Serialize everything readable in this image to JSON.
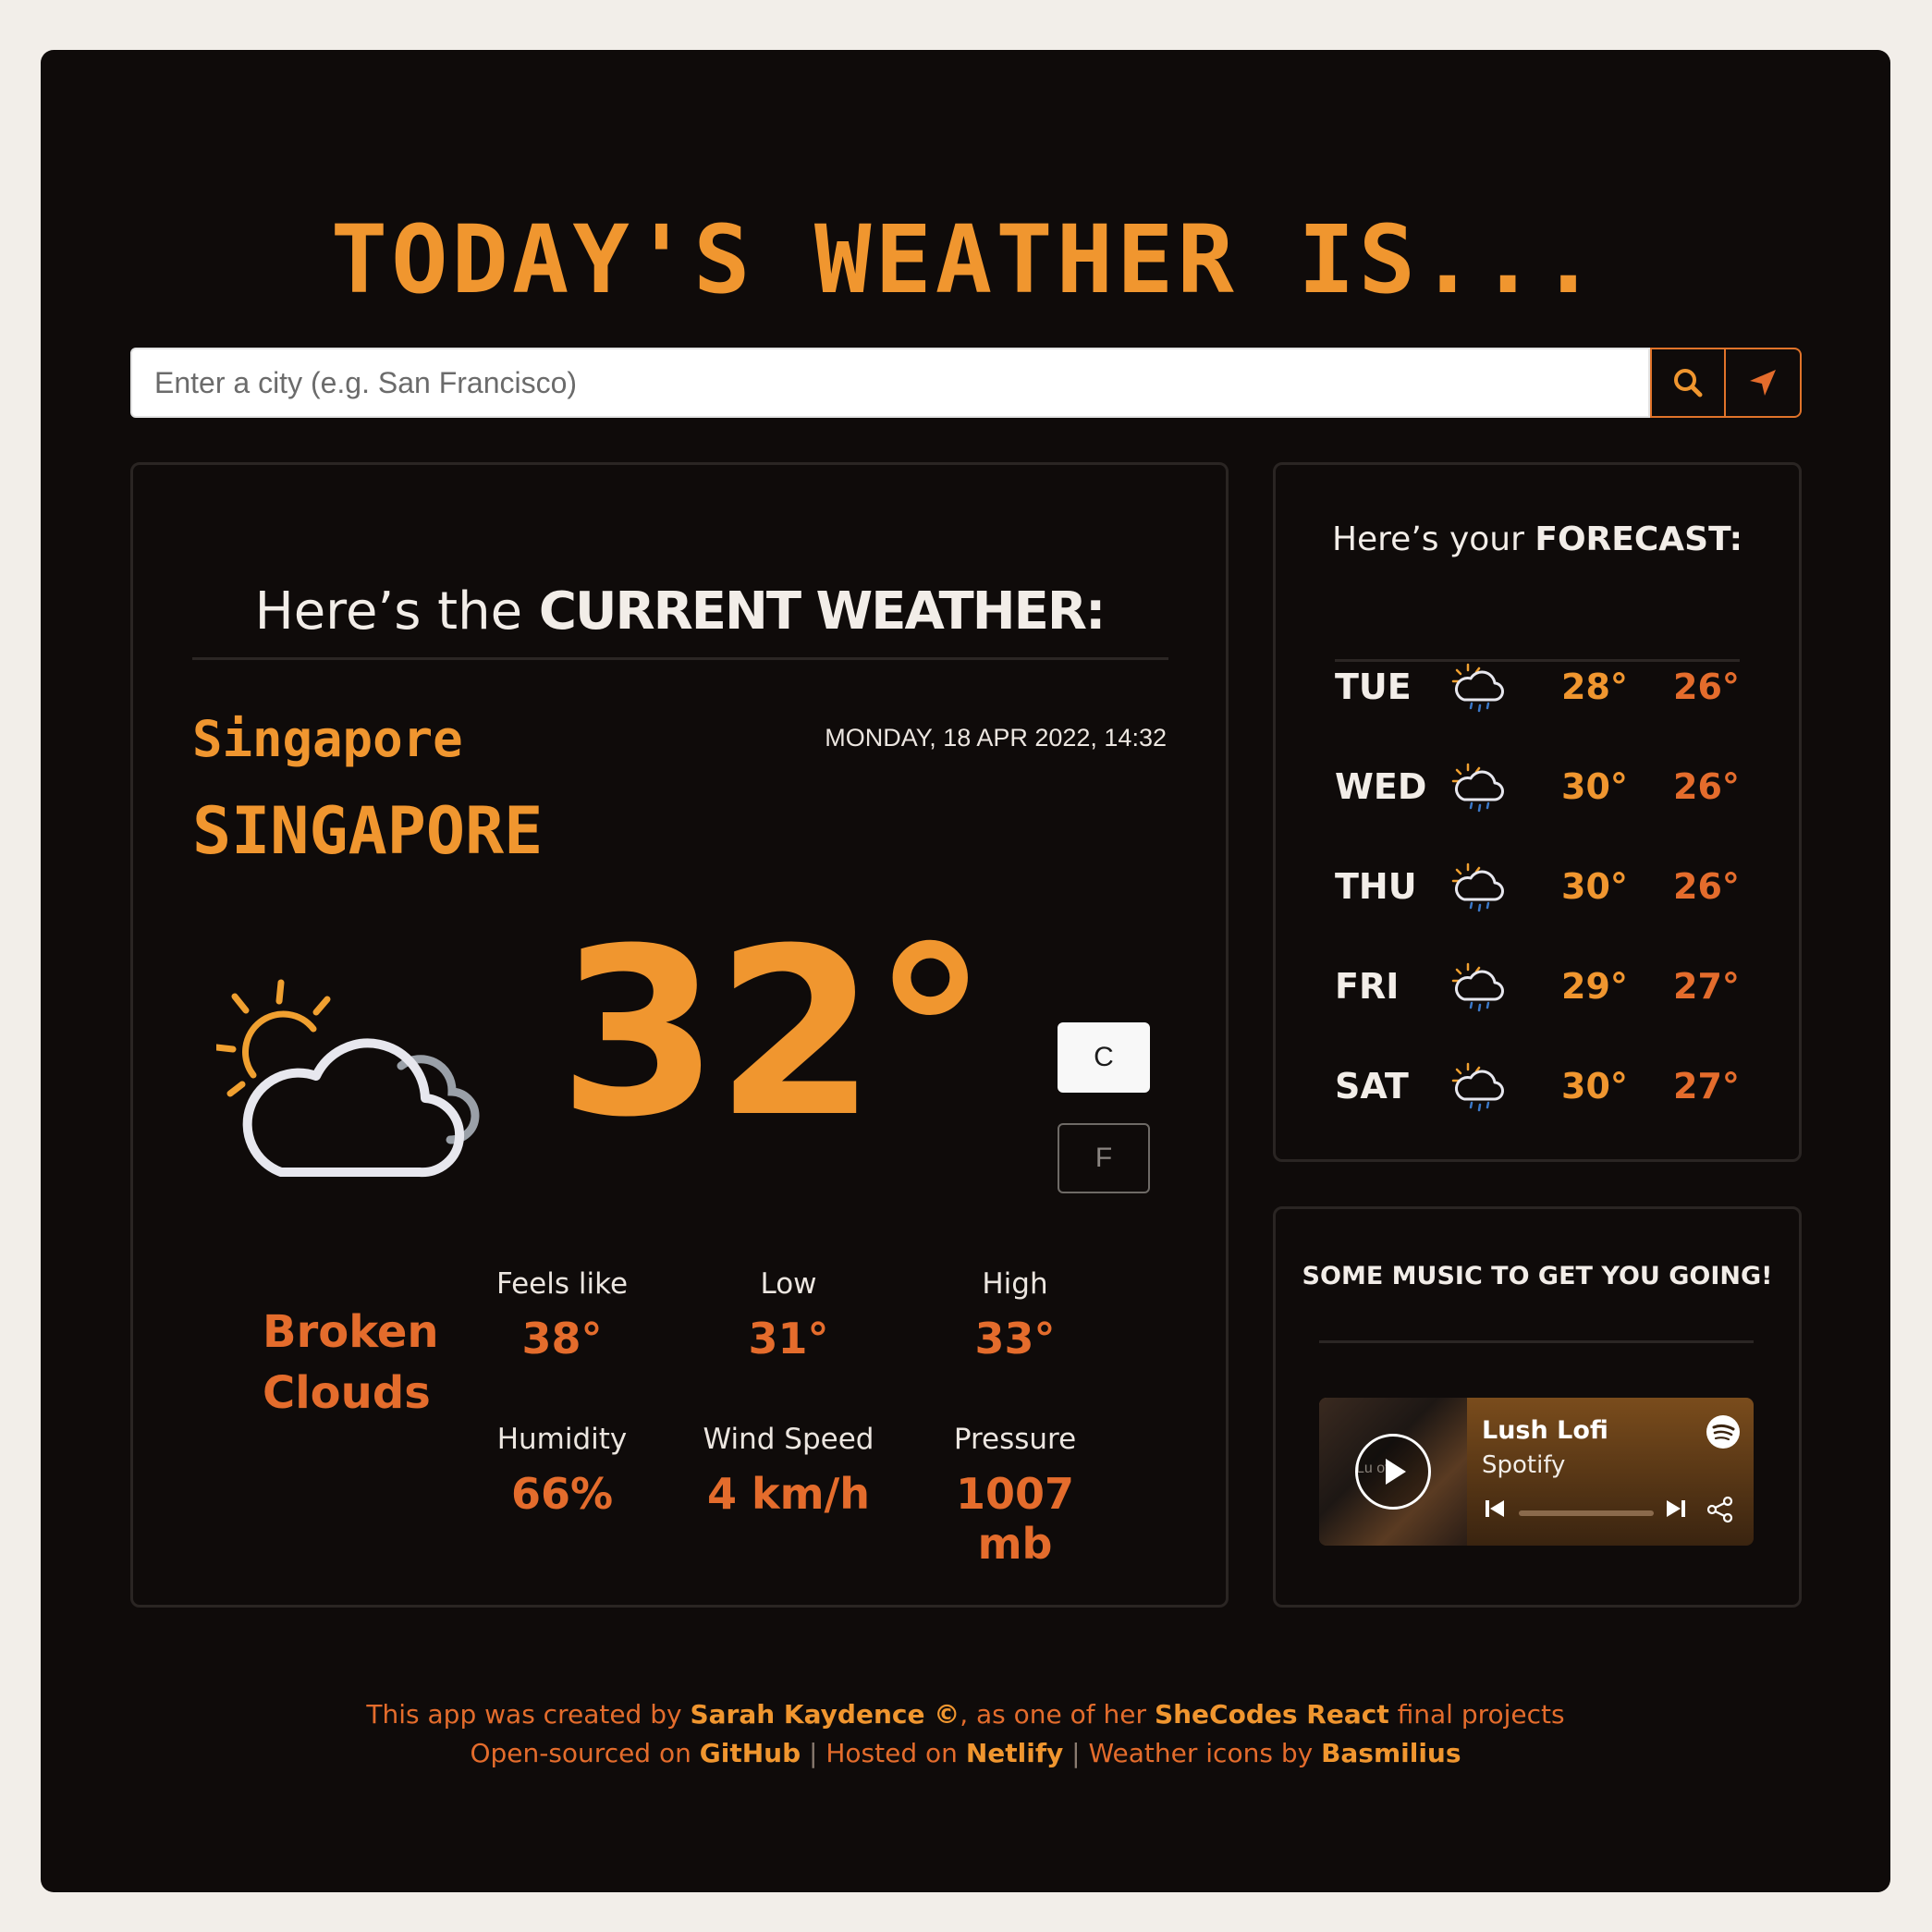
{
  "header": {
    "title": "TODAY'S WEATHER IS..."
  },
  "search": {
    "placeholder": "Enter a city (e.g. San Francisco)",
    "search_icon": "search-icon",
    "locate_icon": "location-arrow-icon"
  },
  "current": {
    "heading_prefix": "Here’s the",
    "heading_bold": "CURRENT WEATHER:",
    "city": "Singapore",
    "country": "SINGAPORE",
    "datetime": "MONDAY, 18 APR 2022, 14:32",
    "icon": "partly-cloudy-day-icon",
    "temperature": "32°",
    "unit_c": "C",
    "unit_f": "F",
    "description": "Broken Clouds",
    "stats": [
      {
        "label": "Feels like",
        "value": "38°"
      },
      {
        "label": "Low",
        "value": "31°"
      },
      {
        "label": "High",
        "value": "33°"
      },
      {
        "label": "Humidity",
        "value": "66%"
      },
      {
        "label": "Wind Speed",
        "value": "4 km/h"
      },
      {
        "label": "Pressure",
        "value": "1007 mb"
      }
    ]
  },
  "forecast": {
    "heading_prefix": "Here’s your",
    "heading_bold": "FORECAST:",
    "days": [
      {
        "day": "TUE",
        "icon": "rain-cloud-sun-icon",
        "high": "28°",
        "low": "26°"
      },
      {
        "day": "WED",
        "icon": "rain-cloud-sun-icon",
        "high": "30°",
        "low": "26°"
      },
      {
        "day": "THU",
        "icon": "rain-cloud-sun-icon",
        "high": "30°",
        "low": "26°"
      },
      {
        "day": "FRI",
        "icon": "rain-cloud-sun-icon",
        "high": "29°",
        "low": "27°"
      },
      {
        "day": "SAT",
        "icon": "rain-cloud-sun-icon",
        "high": "30°",
        "low": "27°"
      }
    ]
  },
  "music": {
    "heading": "SOME MUSIC TO GET YOU GOING!",
    "track": "Lush Lofi",
    "artist": "Spotify",
    "cover_text": "Lu    ofi"
  },
  "footer": {
    "line1": {
      "t1": "This app was created by ",
      "b1": "Sarah Kaydence ©",
      "t2": ", as one of her ",
      "b2": "SheCodes React",
      "t3": " final projects"
    },
    "line2": {
      "t1": "Open-sourced on ",
      "b1": "GitHub",
      "sep1": " | ",
      "t2": "Hosted on ",
      "b2": "Netlify",
      "sep2": " | ",
      "t3": "Weather icons by ",
      "b3": "Basmilius"
    }
  },
  "colors": {
    "background": "#f2eee9",
    "panel": "#0f0b0a",
    "accent": "#f0962f",
    "accent_dark": "#e46c2c"
  }
}
